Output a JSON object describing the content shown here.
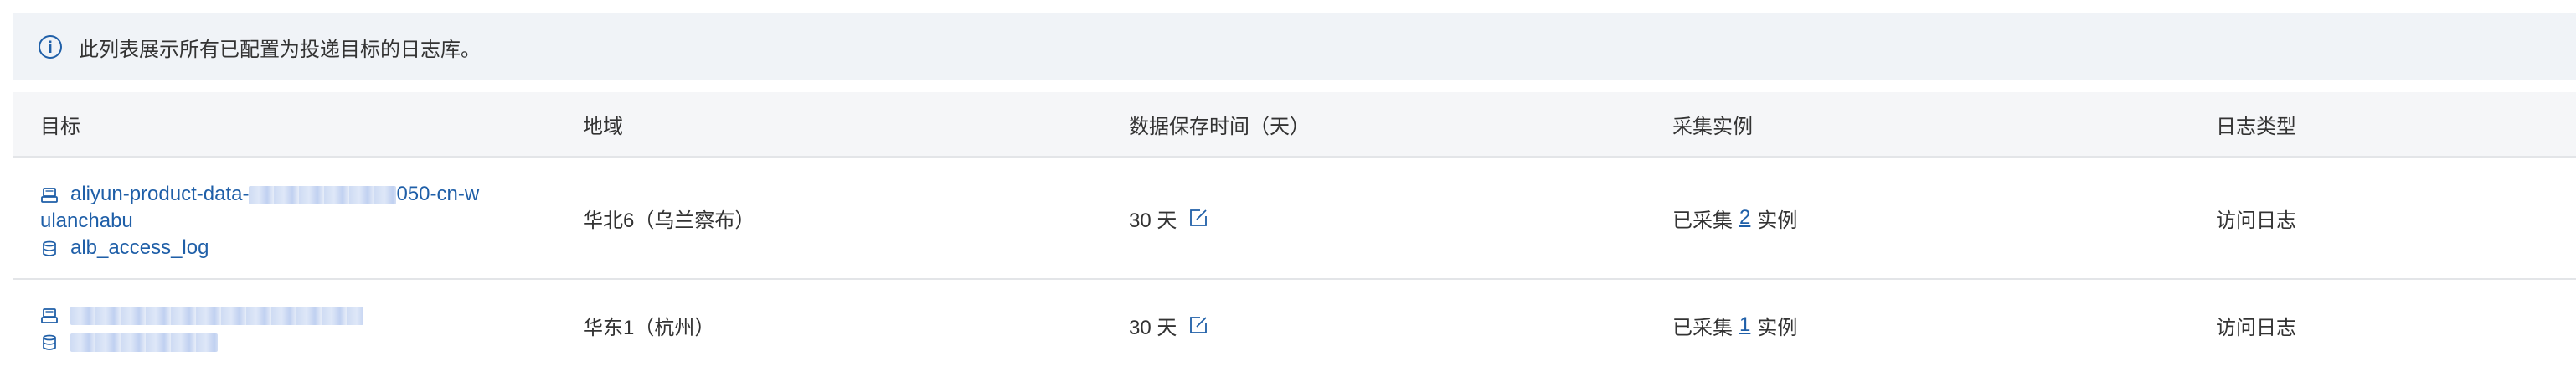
{
  "banner": {
    "icon": "info-icon",
    "text": "此列表展示所有已配置为投递目标的日志库。"
  },
  "table": {
    "headers": [
      "目标",
      "地域",
      "数据保存时间（天）",
      "采集实例",
      "日志类型"
    ],
    "rows": [
      {
        "project": "aliyun-product-data-",
        "project_tail": "050-cn-w",
        "project_wrap": "ulanchabu",
        "logstore": "alb_access_log",
        "region": "华北6（乌兰察布）",
        "retention": "30 天",
        "collect_prefix": "已采集",
        "collect_count": "2",
        "collect_suffix": "实例",
        "log_type": "访问日志"
      },
      {
        "project": "",
        "logstore": "",
        "region": "华东1（杭州）",
        "retention": "30 天",
        "collect_prefix": "已采集",
        "collect_count": "1",
        "collect_suffix": "实例",
        "log_type": "访问日志"
      }
    ]
  },
  "colors": {
    "link": "#1f5fa8",
    "banner_bg": "#f0f3f7",
    "header_bg": "#f5f6f8",
    "border": "#e3e5e8"
  }
}
